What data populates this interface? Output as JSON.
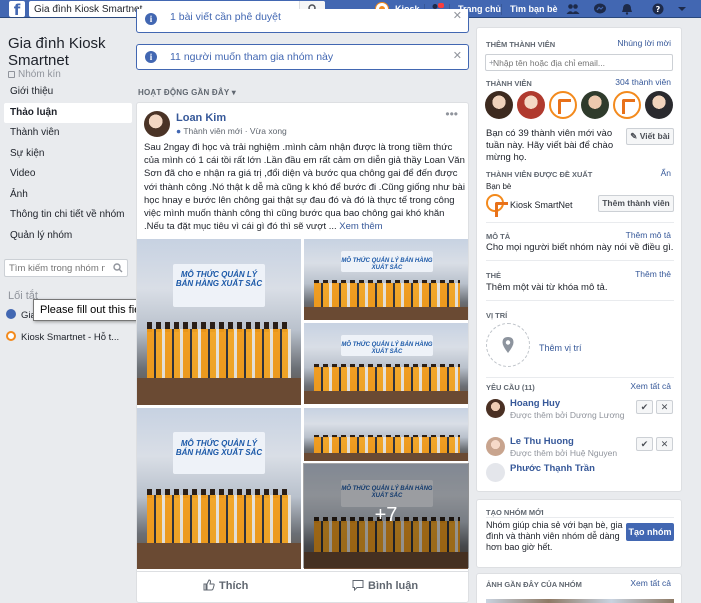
{
  "topbar": {
    "search_value": "Gia đình Kiosk Smartnet",
    "profile_name": "Kiosk",
    "nav_home": "Trang chủ",
    "nav_find_friends": "Tìm bạn bè",
    "logo_letter": "f"
  },
  "left": {
    "group_name": "Gia đình Kiosk Smartnet",
    "group_type": "Nhóm kín",
    "nav_items": [
      {
        "label": "Giới thiệu"
      },
      {
        "label": "Thảo luận"
      },
      {
        "label": "Thành viên"
      },
      {
        "label": "Sự kiện"
      },
      {
        "label": "Video"
      },
      {
        "label": "Ảnh"
      },
      {
        "label": "Thông tin chi tiết về nhóm"
      },
      {
        "label": "Quản lý nhóm"
      }
    ],
    "search_placeholder": "Tìm kiếm trong nhóm n",
    "shortcuts_heading": "Lối tắt",
    "shortcut_1": "Gia",
    "shortcut_2": "Kiosk Smartnet - Hỗ t..."
  },
  "tooltip": "Please fill out this field.",
  "notices": [
    {
      "text": "1 bài viết cần phê duyệt"
    },
    {
      "text": "11 người muốn tham gia nhóm này"
    }
  ],
  "recent_heading": "HOẠT ĐỘNG GẦN ĐÂY",
  "post": {
    "author": "Loan Kim",
    "meta_member": "Thành viên mới",
    "meta_time": "· Vừa xong",
    "text": "Sau 2ngay đi học và trải nghiệm .mình cảm nhận được là trong tiềm thức của mình có 1 cái tồi rất lớn .Lần đầu em rất cảm ơn diễn giả thầy Loan Văn Sơn đã cho e nhận ra giá trị ,đổi diện và bước qua chông gai để đến được với thành công .Nó thật k dễ mà cũng k khó để bước đi .Cũng giống như bài học hnay e bước lên chông gai thật sự đau đó và đó là thực tế trong công việc mình muốn thành công thì cũng bước qua bao chông gai khó khăn .Nếu ta đặt mục tiêu vì cái gì đó thì sẽ vượt ...",
    "see_more": "Xem thêm",
    "photo_banner": "MÔ THỨC QUẢN LÝ BÁN HÀNG XUẤT SẮC",
    "more_photos": "+7",
    "like_label": "Thích",
    "comment_label": "Bình luận"
  },
  "right": {
    "add_members_heading": "THÊM THÀNH VIÊN",
    "invite_link": "Nhúng lời mời",
    "invite_placeholder": "Nhập tên hoặc địa chỉ email...",
    "members_heading": "THÀNH VIÊN",
    "members_count": "304 thành viên",
    "new_members_text": "Bạn có 39 thành viên mới vào tuần này. Hãy viết bài để chào mừng họ.",
    "write_post_btn": "Viết bài",
    "suggested_heading": "THÀNH VIÊN ĐƯỢC ĐỀ XUẤT",
    "hide_link": "Ẩn",
    "friends_label": "Bạn bè",
    "suggested_name": "Kiosk SmartNet",
    "add_member_btn": "Thêm thành viên",
    "desc_heading": "MÔ TẢ",
    "desc_link": "Thêm mô tả",
    "desc_text": "Cho mọi người biết nhóm này nói về điều gì.",
    "tags_heading": "THẺ",
    "tags_link": "Thêm thẻ",
    "tags_text": "Thêm một vài từ khóa mô tả.",
    "location_heading": "VỊ TRÍ",
    "location_text": "Thêm vị trí",
    "requests_heading": "YÊU CẦU (11)",
    "requests_link": "Xem tất cả",
    "requests": [
      {
        "name": "Hoang Huy",
        "sub": "Được thêm bởi Dương Lương"
      },
      {
        "name": "Le Thu Huong",
        "sub": "Được thêm bởi Huệ Nguyen"
      },
      {
        "name": "Phước Thạnh Trần",
        "sub": ""
      }
    ],
    "accept_icon": "✔",
    "decline_icon": "✕",
    "create_heading": "TẠO NHÓM MỚI",
    "create_text": "Nhóm giúp chia sẻ với bạn bè, gia đình và thành viên nhóm dễ dàng hơn bao giờ hết.",
    "create_btn": "Tạo nhóm",
    "photos_heading": "ẢNH GẦN ĐÂY CỦA NHÓM",
    "photos_link": "Xem tất cả"
  },
  "colors": {
    "brand": "#4267b2",
    "link": "#365899",
    "accent_orange": "#f38a1d"
  }
}
